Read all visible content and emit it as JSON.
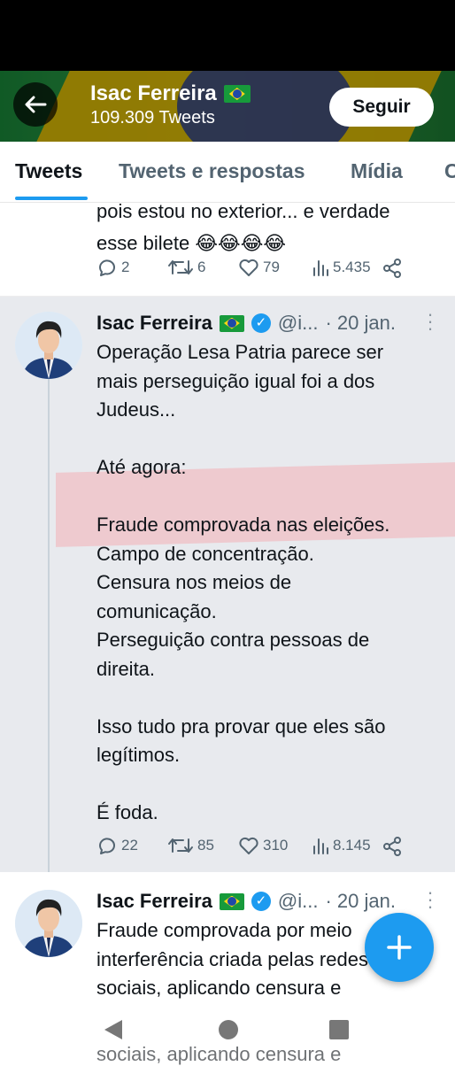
{
  "colors": {
    "accent": "#1d9bf0",
    "text": "#0f1419",
    "muted": "#536471",
    "highlight": "#f2b4ba"
  },
  "profile": {
    "name": "Isac Ferreira",
    "tweet_count": "109.309 Tweets",
    "follow_label": "Seguir",
    "flag": "brazil-flag"
  },
  "tabs": [
    {
      "label": "Tweets",
      "active": true
    },
    {
      "label": "Tweets e respostas"
    },
    {
      "label": "Mídia"
    },
    {
      "label": "C"
    }
  ],
  "prev_tweet": {
    "line1": "pois estou no exterior... e verdade",
    "line2": "esse bilete",
    "emojis": "😂😂😂😂",
    "replies": "2",
    "retweets": "6",
    "likes": "79",
    "views": "5.435"
  },
  "tweet1": {
    "name": "Isac Ferreira",
    "handle": "@i...",
    "date": "· 20 jan.",
    "text": "Operação Lesa Patria parece ser\nmais perseguição igual foi a dos\nJudeus...\n\nAté agora:\n\nFraude comprovada nas eleições.\nCampo de concentração.\nCensura nos meios de\ncomunicação.\nPerseguição contra pessoas de\ndireita.\n\nIsso tudo pra provar que eles são\nlegítimos.\n\nÉ foda.",
    "replies": "22",
    "retweets": "85",
    "likes": "310",
    "views": "8.145"
  },
  "tweet2": {
    "name": "Isac Ferreira",
    "handle": "@i...",
    "date": "· 20 jan.",
    "text": "Fraude comprovada por meio\ninterferência criada pelas redes\nsociais, aplicando censura e",
    "ghost_text": "sociais, aplicando censura e"
  },
  "fab": {
    "icon": "plus-icon"
  },
  "nav": {
    "back": "nav-back-icon",
    "home": "nav-home-icon",
    "recents": "nav-recents-icon"
  }
}
